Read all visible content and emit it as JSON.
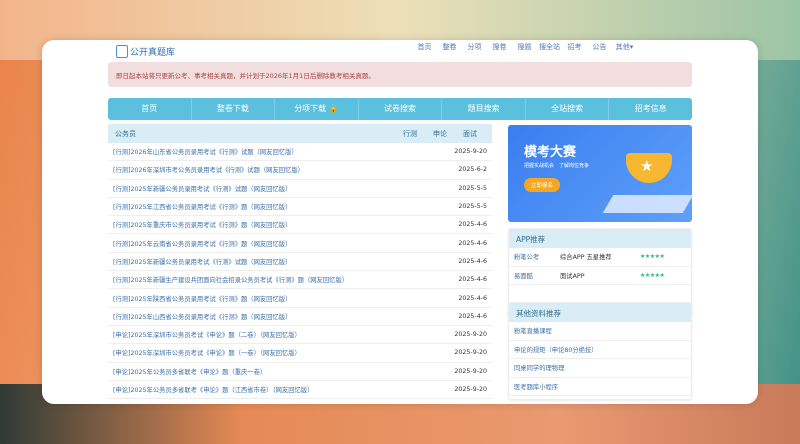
{
  "header": {
    "logo": "公开真题库",
    "nav": [
      "首页",
      "整卷",
      "分项",
      "搜卷",
      "搜题",
      "搜全站",
      "招考",
      "公告",
      "其他▾"
    ]
  },
  "alert": "即日起本站将只更新公考、事考相关真题，并计划于2026年1月1日后删除教考相关真题。",
  "mainnav": [
    "首页",
    "整卷下载",
    "分项下载",
    "试卷搜索",
    "题目搜索",
    "全站搜索",
    "招考信息"
  ],
  "list": {
    "title": "公务员",
    "cols": [
      "行测",
      "申论",
      "面试"
    ],
    "rows": [
      {
        "t": "[行测]2026年山东省公务员录用考试《行测》试题（网友回忆版）",
        "d": "2025-9-20"
      },
      {
        "t": "[行测]2026年深圳市考公务员录用考试《行测》试题（网友回忆版）",
        "d": "2025-6-2"
      },
      {
        "t": "[行测]2025年新疆公务员录用考试《行测》试题（网友回忆版）",
        "d": "2025-5-5"
      },
      {
        "t": "[行测]2025年江西省公务员录用考试《行测》题（网友回忆版）",
        "d": "2025-5-5"
      },
      {
        "t": "[行测]2025年重庆市公务员录用考试《行测》题（网友回忆版）",
        "d": "2025-4-6"
      },
      {
        "t": "[行测]2025年云南省公务员录用考试《行测》题（网友回忆版）",
        "d": "2025-4-6"
      },
      {
        "t": "[行测]2025年新疆公务员录用考试《行测》试题（网友回忆版）",
        "d": "2025-4-6"
      },
      {
        "t": "[行测]2025年新疆生产建设兵团面向社会招录公务员考试《行测》题（网友回忆版）",
        "d": "2025-4-6"
      },
      {
        "t": "[行测]2025年陕西省公务员录用考试《行测》题（网友回忆版）",
        "d": "2025-4-6"
      },
      {
        "t": "[行测]2025年山西省公务员录用考试《行测》题（网友回忆版）",
        "d": "2025-4-6"
      },
      {
        "t": "[申论]2025年深圳市公务员考试《申论》题（二卷）（网友回忆版）",
        "d": "2025-9-20"
      },
      {
        "t": "[申论]2025年深圳市公务员考试《申论》题（一卷）（网友回忆版）",
        "d": "2025-9-20"
      },
      {
        "t": "[申论]2025年公务员多省联考《申论》题（重庆一卷）",
        "d": "2025-9-20"
      },
      {
        "t": "[申论]2025年公务员多省联考《申论》题（江西省市卷）（网友回忆版）",
        "d": "2025-9-20"
      }
    ]
  },
  "banner": {
    "title": "模考大赛",
    "sub": "把握实战机会　了解岗位竞争",
    "btn": "立即报名"
  },
  "app": {
    "title": "APP推荐",
    "rows": [
      {
        "n": "粉笔公考",
        "d": "综合APP 五星推荐",
        "s": "★★★★★",
        "rating": 5
      },
      {
        "n": "易面酷",
        "d": "面试APP",
        "s": "★★★★★",
        "rating": 5
      }
    ]
  },
  "other": {
    "title": "其他资料推荐",
    "items": [
      "粉笔直播课程",
      "申论的规矩（申论80分绝技）",
      "同桌同学的理物理",
      "医考题库小程序"
    ]
  }
}
